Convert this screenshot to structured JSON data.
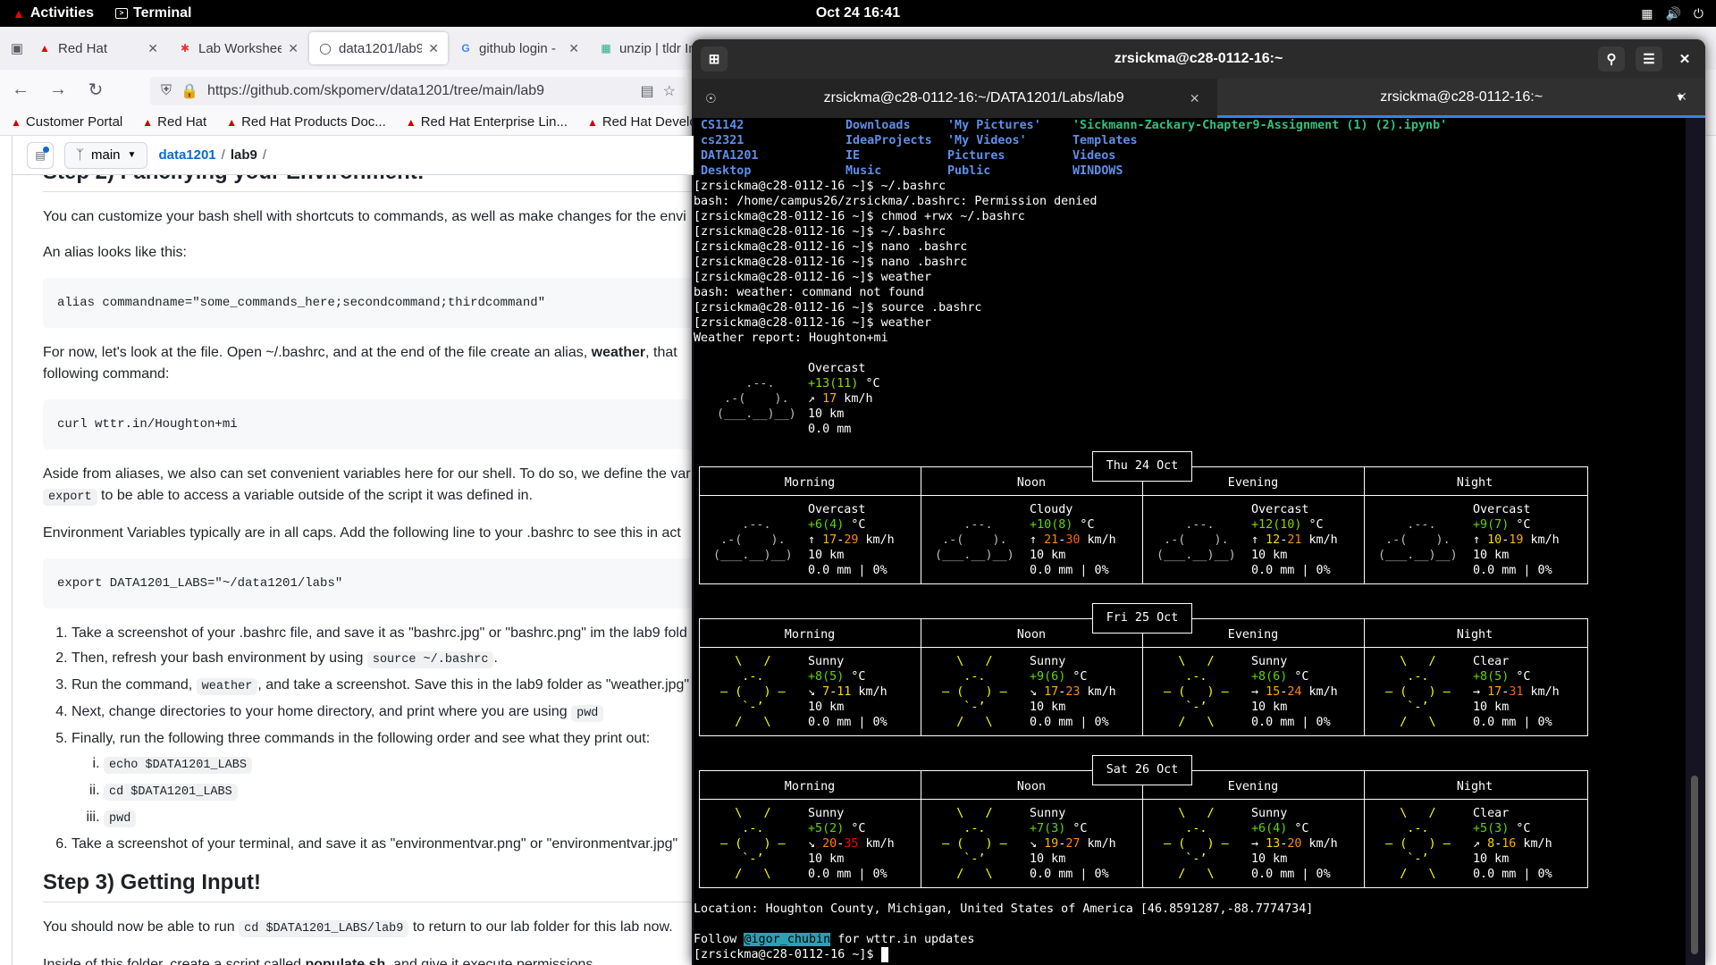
{
  "topbar": {
    "activities": "Activities",
    "app": "Terminal",
    "clock": "Oct 24  16:41"
  },
  "browser": {
    "tabs": [
      {
        "title": "Red Hat",
        "icon": "redhat-icon"
      },
      {
        "title": "Lab Workshee",
        "icon": "lab-icon"
      },
      {
        "title": "data1201/lab9",
        "icon": "github-icon"
      },
      {
        "title": "github login -",
        "icon": "google-icon"
      },
      {
        "title": "unzip | tldr In",
        "icon": "tldr-icon"
      }
    ],
    "url": "https://github.com/skpomerv/data1201/tree/main/lab9",
    "bookmarks": [
      "Customer Portal",
      "Red Hat",
      "Red Hat Products Doc...",
      "Red Hat Enterprise Lin...",
      "Red Hat Developer P"
    ]
  },
  "github": {
    "branch": "main",
    "repo": "data1201",
    "sep": "/",
    "folder": "lab9",
    "trail": "/",
    "step2_title": "Step 2) Fancifying your Environment!",
    "p1": "You can customize your bash shell with shortcuts to commands, as well as make changes for the envi",
    "p2": "An alias looks like this:",
    "code1": "alias commandname=\"some_commands_here;secondcommand;thirdcommand\"",
    "p3a": "For now, let's look at the file. Open ~/.bashrc, and at the end of the file create an alias, ",
    "p3b": "weather",
    "p3c": ", that",
    "p3d": "following command:",
    "code2": "curl wttr.in/Houghton+mi",
    "p4a": "Aside from aliases, we also can set convenient variables here for our shell. To do so, we define the var",
    "p4b": "export",
    "p4c": " to be able to access a variable outside of the script it was defined in.",
    "p5": "Environment Variables typically are in all caps. Add the following line to your .bashrc to see this in act",
    "code3": "export DATA1201_LABS=\"~/data1201/labs\"",
    "steps": {
      "s1": "Take a screenshot of your .bashrc file, and save it as \"bashrc.jpg\" or \"bashrc.png\" im the lab9 fold",
      "s2a": "Then, refresh your bash environment by using ",
      "s2b": "source ~/.bashrc",
      "s2c": ".",
      "s3a": "Run the command, ",
      "s3b": "weather",
      "s3c": ", and take a screenshot. Save this in the lab9 folder as \"weather.jpg\"",
      "s4a": "Next, change directories to your home directory, and print where you are using ",
      "s4b": "pwd",
      "s5": "Finally, run the following three commands in the following order and see what they print out:",
      "sub1": "echo $DATA1201_LABS",
      "sub2": "cd $DATA1201_LABS",
      "sub3": "pwd",
      "s6": "Take a screenshot of your terminal, and save it as \"environmentvar.png\" or \"environmentvar.jpg\""
    },
    "step3_title": "Step 3) Getting Input!",
    "p6a": "You should now be able to run ",
    "p6b": "cd $DATA1201_LABS/lab9",
    "p6c": " to return to our lab folder for this lab now.",
    "p7a": "Inside of this folder, create a script called ",
    "p7b": "populate.sh",
    "p7c": ", and give it execute permissions."
  },
  "terminal": {
    "title": "zrsickma@c28-0112-16:~",
    "tabs": [
      "zrsickma@c28-0112-16:~/DATA1201/Labs/lab9",
      "zrsickma@c28-0112-16:~"
    ],
    "ls_rows": [
      [
        "CS1142",
        "Downloads",
        "'My Pictures'",
        "'Sickmann-Zackary-Chapter9-Assignment (1) (2).ipynb'"
      ],
      [
        "cs2321",
        "IdeaProjects",
        "'My Videos'",
        "Templates"
      ],
      [
        "DATA1201",
        "IE",
        "Pictures",
        "Videos"
      ],
      [
        "Desktop",
        "Music",
        "Public",
        "WINDOWS"
      ]
    ],
    "prompt": "[zrsickma@c28-0112-16 ~]$ ",
    "history": [
      {
        "cmd": "~/.bashrc"
      },
      {
        "out": "bash: /home/campus26/zrsickma/.bashrc: Permission denied"
      },
      {
        "cmd": "chmod +rwx ~/.bashrc"
      },
      {
        "cmd": "~/.bashrc"
      },
      {
        "cmd": "nano .bashrc"
      },
      {
        "cmd": "nano .bashrc"
      },
      {
        "cmd": "weather"
      },
      {
        "out": "bash: weather: command not found"
      },
      {
        "cmd": "source .bashrc"
      },
      {
        "cmd": "weather"
      },
      {
        "out": "Weather report: Houghton+mi"
      }
    ],
    "current": {
      "cond": "Overcast",
      "temp_a": "+13",
      "temp_b": "(11)",
      "temp_unit": " °C",
      "wind_arrow": "↗",
      "wind": "17",
      "wind_unit": " km/h",
      "vis": "10 km",
      "precip": "0.0 mm"
    },
    "periods": [
      "Morning",
      "Noon",
      "Evening",
      "Night"
    ],
    "days": [
      {
        "date": "Thu 24 Oct",
        "cells": [
          {
            "art": "cloud",
            "cond": "Overcast",
            "ta": "+6",
            "tb": "(4)",
            "arrow": "↑",
            "w1": "17",
            "w2": "29",
            "vis": "10 km",
            "pr": "0.0 mm | 0%"
          },
          {
            "art": "cloud",
            "cond": "Cloudy",
            "ta": "+10",
            "tb": "(8)",
            "arrow": "↑",
            "w1": "21",
            "w2": "30",
            "vis": "10 km",
            "pr": "0.0 mm | 0%"
          },
          {
            "art": "cloud",
            "cond": "Overcast",
            "ta": "+12",
            "tb": "(10)",
            "arrow": "↑",
            "w1": "12",
            "w2": "21",
            "vis": "10 km",
            "pr": "0.0 mm | 0%"
          },
          {
            "art": "cloud",
            "cond": "Overcast",
            "ta": "+9",
            "tb": "(7)",
            "arrow": "↑",
            "w1": "10",
            "w2": "19",
            "vis": "10 km",
            "pr": "0.0 mm | 0%"
          }
        ]
      },
      {
        "date": "Fri 25 Oct",
        "cells": [
          {
            "art": "sun",
            "cond": "Sunny",
            "ta": "+8",
            "tb": "(5)",
            "arrow": "↘",
            "w1": "7",
            "w2": "11",
            "vis": "10 km",
            "pr": "0.0 mm | 0%"
          },
          {
            "art": "sun",
            "cond": "Sunny",
            "ta": "+9",
            "tb": "(6)",
            "arrow": "↘",
            "w1": "17",
            "w2": "23",
            "vis": "10 km",
            "pr": "0.0 mm | 0%"
          },
          {
            "art": "sun",
            "cond": "Sunny",
            "ta": "+8",
            "tb": "(6)",
            "arrow": "→",
            "w1": "15",
            "w2": "24",
            "vis": "10 km",
            "pr": "0.0 mm | 0%"
          },
          {
            "art": "sun",
            "cond": "Clear",
            "ta": "+8",
            "tb": "(5)",
            "arrow": "→",
            "w1": "17",
            "w2": "31",
            "vis": "10 km",
            "pr": "0.0 mm | 0%"
          }
        ]
      },
      {
        "date": "Sat 26 Oct",
        "cells": [
          {
            "art": "sun",
            "cond": "Sunny",
            "ta": "+5",
            "tb": "(2)",
            "arrow": "↘",
            "w1": "20",
            "w2": "35",
            "vis": "10 km",
            "pr": "0.0 mm | 0%"
          },
          {
            "art": "sun",
            "cond": "Sunny",
            "ta": "+7",
            "tb": "(3)",
            "arrow": "↘",
            "w1": "19",
            "w2": "27",
            "vis": "10 km",
            "pr": "0.0 mm | 0%"
          },
          {
            "art": "sun",
            "cond": "Sunny",
            "ta": "+6",
            "tb": "(4)",
            "arrow": "→",
            "w1": "13",
            "w2": "20",
            "vis": "10 km",
            "pr": "0.0 mm | 0%"
          },
          {
            "art": "sun",
            "cond": "Clear",
            "ta": "+5",
            "tb": "(3)",
            "arrow": "↗",
            "w1": "8",
            "w2": "16",
            "vis": "10 km",
            "pr": "0.0 mm | 0%"
          }
        ]
      }
    ],
    "location": "Location: Houghton County, Michigan, United States of America [46.8591287,-88.7774734]",
    "follow_a": "Follow ",
    "follow_handle": "@igor_chubin",
    "follow_b": " for wttr.in updates"
  }
}
